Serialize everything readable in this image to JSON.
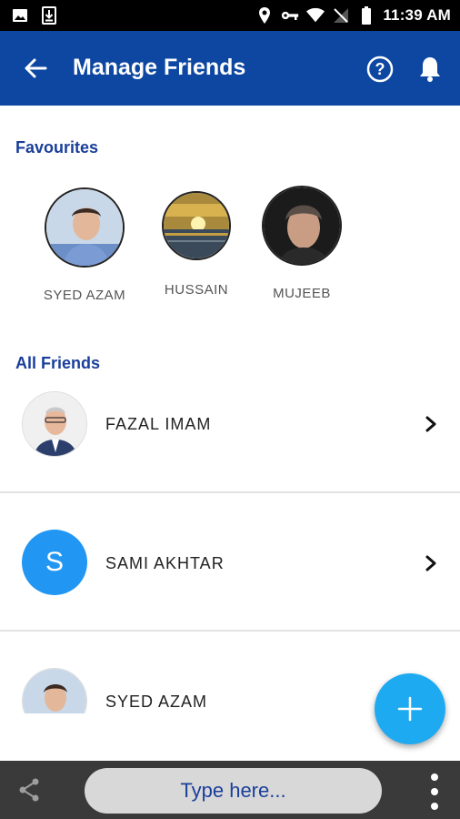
{
  "status_bar": {
    "time": "11:39 AM",
    "icons": [
      "image-icon",
      "download-icon",
      "location-icon",
      "vpn-key-icon",
      "wifi-icon",
      "no-signal-icon",
      "battery-icon"
    ]
  },
  "app_bar": {
    "title": "Manage Friends",
    "color": "#0d47a1",
    "icons": [
      "back-arrow-icon",
      "help-icon",
      "bell-icon"
    ]
  },
  "favourites": {
    "header": "Favourites",
    "items": [
      {
        "name": "SYED AZAM"
      },
      {
        "name": "HUSSAIN"
      },
      {
        "name": "MUJEEB"
      }
    ]
  },
  "all_friends": {
    "header": "All Friends",
    "items": [
      {
        "name": "FAZAL IMAM",
        "avatar_type": "photo"
      },
      {
        "name": "SAMI AKHTAR",
        "avatar_type": "letter",
        "initial": "S",
        "avatar_color": "#2196f3"
      },
      {
        "name": "SYED AZAM",
        "avatar_type": "photo"
      }
    ]
  },
  "fab": {
    "icon": "plus-icon",
    "color": "#1eaaf1"
  },
  "bottom_bar": {
    "input_placeholder": "Type here...",
    "icons": [
      "share-icon",
      "more-vert-icon"
    ]
  }
}
